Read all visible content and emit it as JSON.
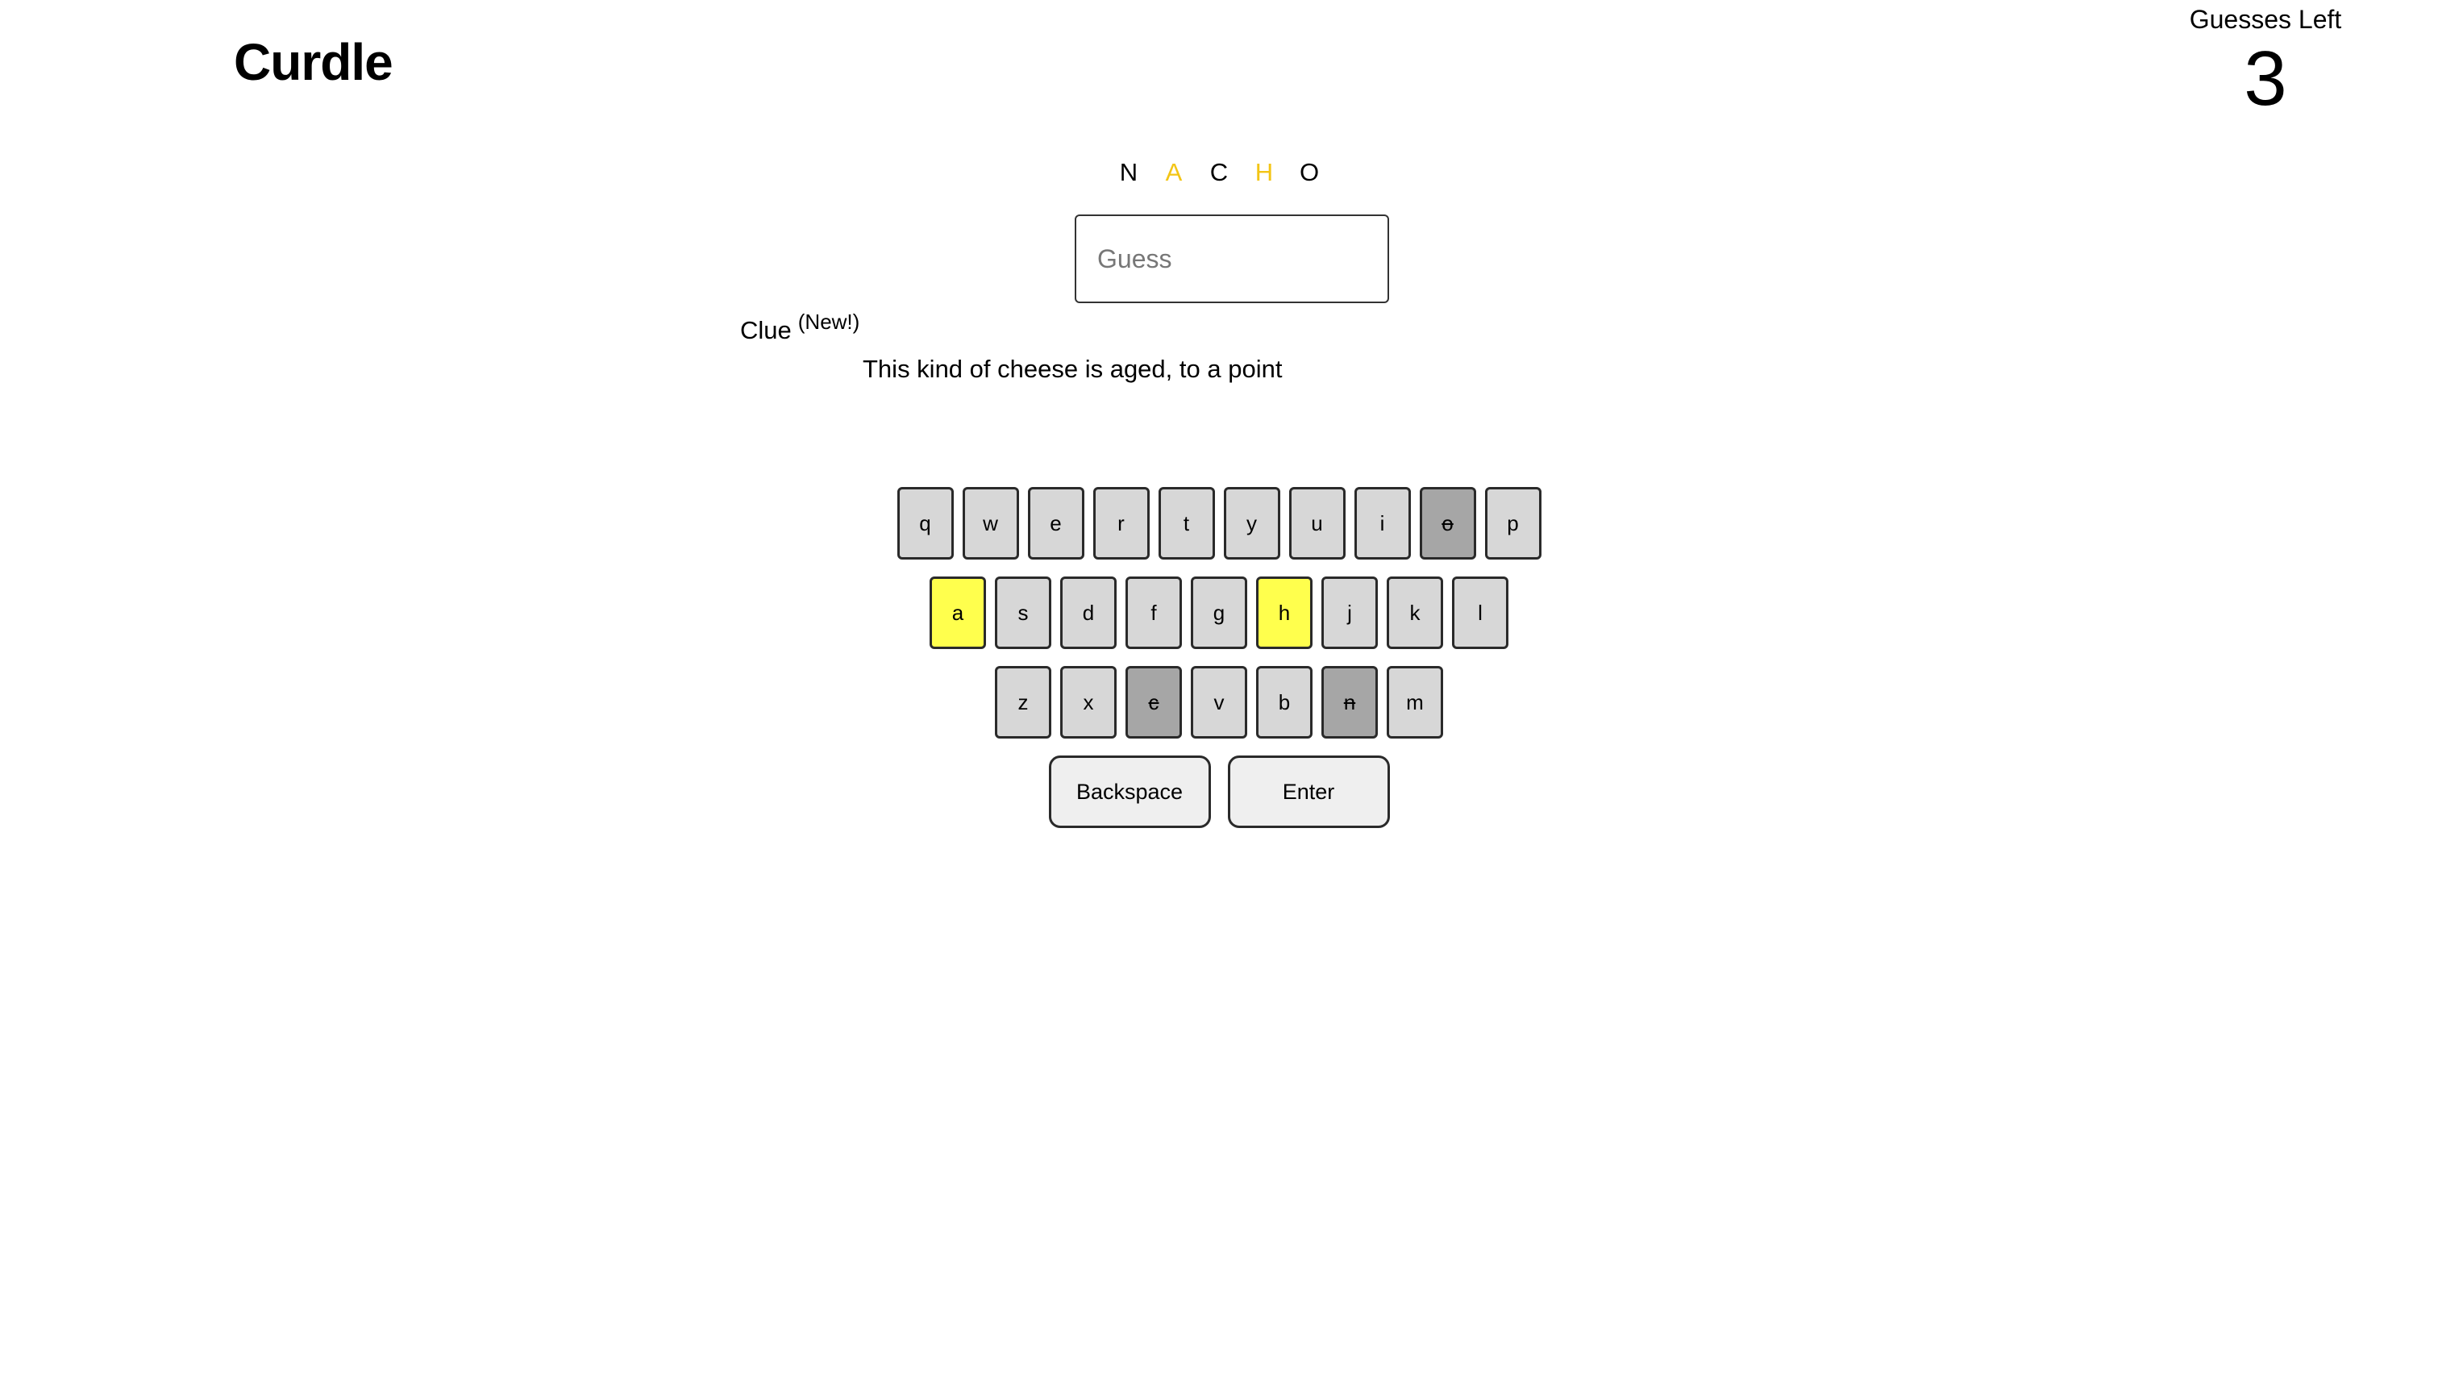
{
  "header": {
    "title": "Curdle",
    "guesses_label": "Guesses Left",
    "guesses_count": "3"
  },
  "previous_guess": {
    "letters": [
      {
        "char": "N",
        "status": "absent"
      },
      {
        "char": "A",
        "status": "present"
      },
      {
        "char": "C",
        "status": "absent"
      },
      {
        "char": "H",
        "status": "present"
      },
      {
        "char": "O",
        "status": "absent"
      }
    ]
  },
  "guess_input": {
    "value": "",
    "placeholder": "Guess"
  },
  "clue": {
    "heading": "Clue",
    "badge": "(New!)",
    "text": "This kind of cheese is aged, to a point"
  },
  "colors": {
    "present_text": "#f3c516",
    "present_key": "#ffff4d",
    "absent_key": "#a6a6a6",
    "default_key": "#d7d7d7"
  },
  "keyboard": {
    "row1": [
      {
        "label": "q",
        "state": "unused"
      },
      {
        "label": "w",
        "state": "unused"
      },
      {
        "label": "e",
        "state": "unused"
      },
      {
        "label": "r",
        "state": "unused"
      },
      {
        "label": "t",
        "state": "unused"
      },
      {
        "label": "y",
        "state": "unused"
      },
      {
        "label": "u",
        "state": "unused"
      },
      {
        "label": "i",
        "state": "unused"
      },
      {
        "label": "o",
        "state": "absent"
      },
      {
        "label": "p",
        "state": "unused"
      }
    ],
    "row2": [
      {
        "label": "a",
        "state": "present"
      },
      {
        "label": "s",
        "state": "unused"
      },
      {
        "label": "d",
        "state": "unused"
      },
      {
        "label": "f",
        "state": "unused"
      },
      {
        "label": "g",
        "state": "unused"
      },
      {
        "label": "h",
        "state": "present"
      },
      {
        "label": "j",
        "state": "unused"
      },
      {
        "label": "k",
        "state": "unused"
      },
      {
        "label": "l",
        "state": "unused"
      }
    ],
    "row3": [
      {
        "label": "z",
        "state": "unused"
      },
      {
        "label": "x",
        "state": "unused"
      },
      {
        "label": "c",
        "state": "absent"
      },
      {
        "label": "v",
        "state": "unused"
      },
      {
        "label": "b",
        "state": "unused"
      },
      {
        "label": "n",
        "state": "absent"
      },
      {
        "label": "m",
        "state": "unused"
      }
    ],
    "backspace_label": "Backspace",
    "enter_label": "Enter"
  }
}
